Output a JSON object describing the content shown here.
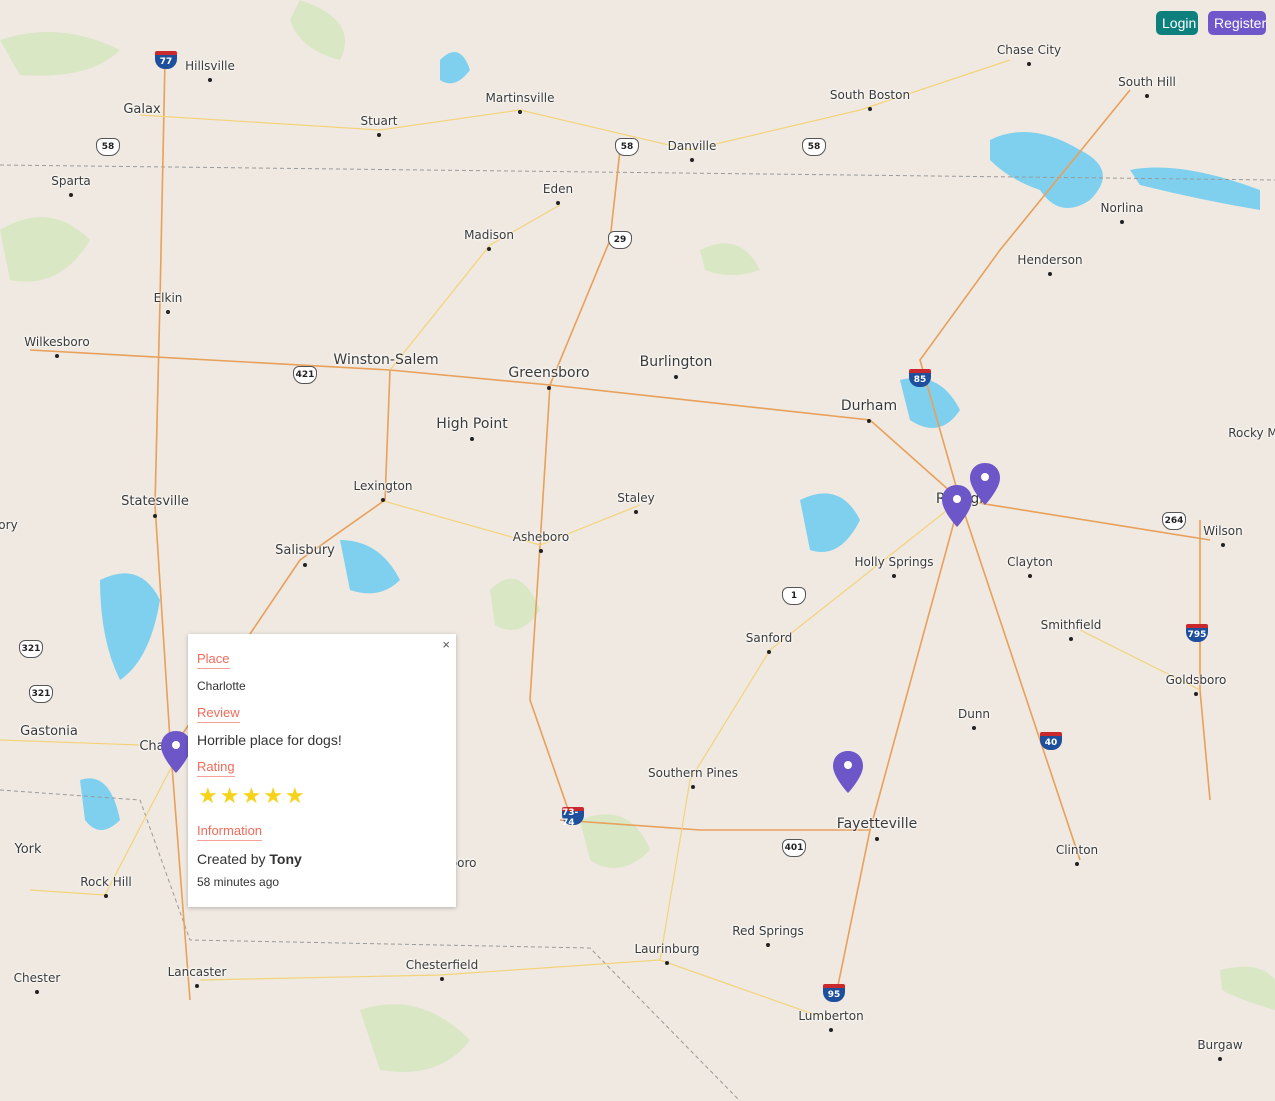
{
  "auth": {
    "login_label": "Login",
    "register_label": "Register"
  },
  "cities": [
    {
      "name": "Hillsville",
      "size": "small"
    },
    {
      "name": "Galax",
      "size": "medium"
    },
    {
      "name": "Martinsville",
      "size": "small"
    },
    {
      "name": "Stuart",
      "size": "small"
    },
    {
      "name": "Danville",
      "size": "small"
    },
    {
      "name": "South Boston",
      "size": "small"
    },
    {
      "name": "Chase City",
      "size": "small"
    },
    {
      "name": "South Hill",
      "size": "small"
    },
    {
      "name": "Sparta",
      "size": "small"
    },
    {
      "name": "Eden",
      "size": "small"
    },
    {
      "name": "Madison",
      "size": "small"
    },
    {
      "name": "Norlina",
      "size": "small"
    },
    {
      "name": "Henderson",
      "size": "small"
    },
    {
      "name": "Elkin",
      "size": "small"
    },
    {
      "name": "Wilkesboro",
      "size": "small"
    },
    {
      "name": "Winston-Salem",
      "size": "big"
    },
    {
      "name": "Greensboro",
      "size": "big"
    },
    {
      "name": "Burlington",
      "size": "big"
    },
    {
      "name": "Durham",
      "size": "big"
    },
    {
      "name": "High Point",
      "size": "big"
    },
    {
      "name": "Rocky M",
      "size": "small"
    },
    {
      "name": "Lexington",
      "size": "small"
    },
    {
      "name": "Staley",
      "size": "small"
    },
    {
      "name": "Raleigh",
      "size": "big"
    },
    {
      "name": "Statesville",
      "size": "medium"
    },
    {
      "name": "Wilson",
      "size": "small"
    },
    {
      "name": "Asheboro",
      "size": "small"
    },
    {
      "name": "Salisbury",
      "size": "medium"
    },
    {
      "name": "Holly Springs",
      "size": "small"
    },
    {
      "name": "Clayton",
      "size": "small"
    },
    {
      "name": "Sanford",
      "size": "small"
    },
    {
      "name": "Smithfield",
      "size": "small"
    },
    {
      "name": "Goldsboro",
      "size": "small"
    },
    {
      "name": "Dunn",
      "size": "small"
    },
    {
      "name": "Gastonia",
      "size": "medium"
    },
    {
      "name": "Southern Pines",
      "size": "small"
    },
    {
      "name": "Fayetteville",
      "size": "big"
    },
    {
      "name": "York",
      "size": "medium"
    },
    {
      "name": "Clinton",
      "size": "small"
    },
    {
      "name": "Rock Hill",
      "size": "small"
    },
    {
      "name": "Red Springs",
      "size": "small"
    },
    {
      "name": "Laurinburg",
      "size": "small"
    },
    {
      "name": "Lancaster",
      "size": "small"
    },
    {
      "name": "Chesterfield",
      "size": "small"
    },
    {
      "name": "Chester",
      "size": "small"
    },
    {
      "name": "Lumberton",
      "size": "small"
    },
    {
      "name": "Burgaw",
      "size": "small"
    },
    {
      "name": "ory",
      "size": "small"
    },
    {
      "name": "Cha",
      "size": "medium"
    },
    {
      "name": "boro",
      "size": "small"
    }
  ],
  "shields": [
    {
      "label": "77",
      "type": "i"
    },
    {
      "label": "58",
      "type": "us"
    },
    {
      "label": "58",
      "type": "us"
    },
    {
      "label": "58",
      "type": "us"
    },
    {
      "label": "29",
      "type": "us"
    },
    {
      "label": "421",
      "type": "us"
    },
    {
      "label": "85",
      "type": "i"
    },
    {
      "label": "264",
      "type": "us"
    },
    {
      "label": "1",
      "type": "us"
    },
    {
      "label": "321",
      "type": "us"
    },
    {
      "label": "321",
      "type": "us"
    },
    {
      "label": "795",
      "type": "i"
    },
    {
      "label": "40",
      "type": "i"
    },
    {
      "label": "73-74",
      "type": "i"
    },
    {
      "label": "401",
      "type": "us"
    },
    {
      "label": "95",
      "type": "i"
    }
  ],
  "markers": [
    {
      "name": "Charlotte"
    },
    {
      "name": "Raleigh A"
    },
    {
      "name": "Raleigh B"
    },
    {
      "name": "Fayetteville"
    }
  ],
  "popup": {
    "close": "×",
    "place_label": "Place",
    "place_value": "Charlotte",
    "review_label": "Review",
    "review_value": "Horrible place for dogs!",
    "rating_label": "Rating",
    "rating": 5,
    "information_label": "Information",
    "created_by_prefix": "Created by",
    "author": "Tony",
    "time_ago": "58 minutes ago"
  },
  "colors": {
    "land": "#efe9e1",
    "water": "#76cfee",
    "forest": "#cfe6b4",
    "major_road": "#e8a05a",
    "minor_road": "#f3d37a",
    "marker": "#6d56c8"
  }
}
